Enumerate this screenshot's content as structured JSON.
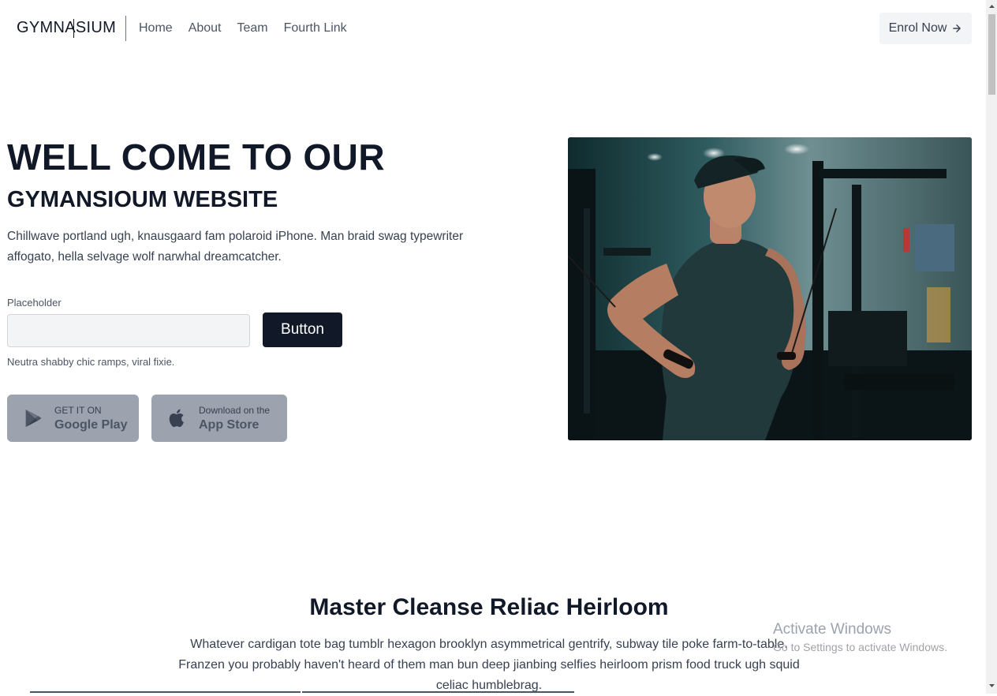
{
  "header": {
    "logo": "GYMNASIUM",
    "nav": [
      "Home",
      "About",
      "Team",
      "Fourth Link"
    ],
    "cta_label": "Enrol Now"
  },
  "hero": {
    "title_line1": "WELL COME TO OUR",
    "title_line2": "GYMANSIOUM WEBSITE",
    "description": "Chillwave portland ugh, knausgaard fam polaroid iPhone. Man braid swag typewriter affogato, hella selvage wolf narwhal dreamcatcher.",
    "field_label": "Placeholder",
    "field_value": "",
    "button_label": "Button",
    "help_text": "Neutra shabby chic ramps, viral fixie.",
    "google_play": {
      "small": "GET IT ON",
      "big": "Google Play"
    },
    "app_store": {
      "small": "Download on the",
      "big": "App Store"
    }
  },
  "section": {
    "title": "Master Cleanse Reliac Heirloom",
    "text": "Whatever cardigan tote bag tumblr hexagon brooklyn asymmetrical gentrify, subway tile poke farm-to-table. Franzen you probably haven't heard of them man bun deep jianbing selfies heirloom prism food truck ugh squid celiac humblebrag."
  },
  "watermark": {
    "title": "Activate Windows",
    "subtitle": "Go to Settings to activate Windows."
  },
  "colors": {
    "primary_dark": "#111827",
    "store_button_bg": "#9ca3af",
    "cta_bg": "#f3f4f6"
  },
  "icons": {
    "enrol": "arrow-right-icon",
    "google_play": "google-play-icon",
    "app_store": "apple-icon"
  }
}
